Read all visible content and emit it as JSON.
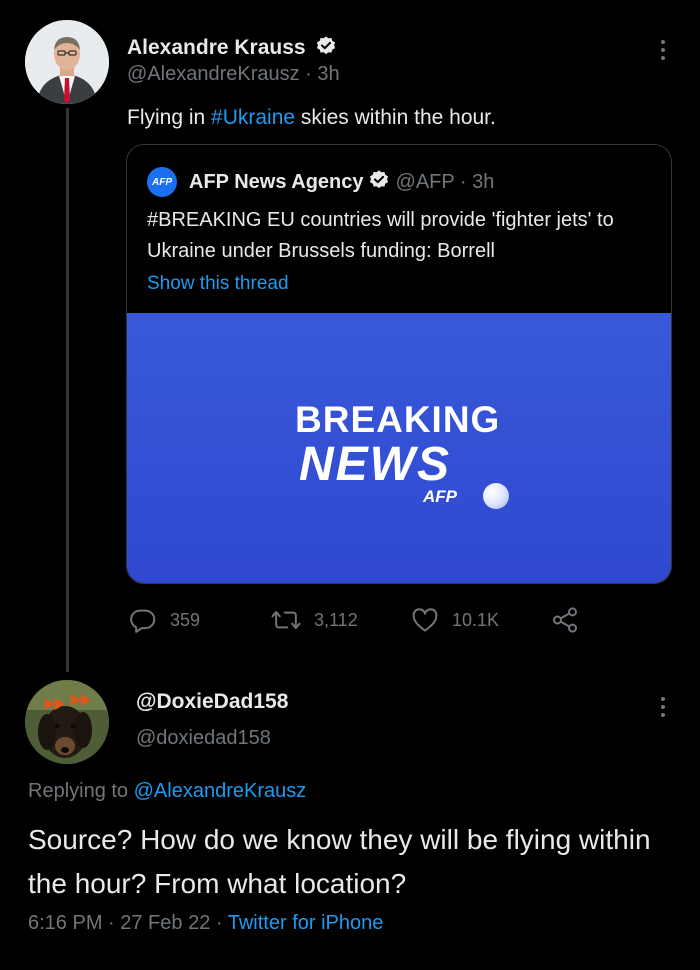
{
  "tweet": {
    "author_name": "Alexandre Krauss",
    "author_handle": "@AlexandreKrausz · 3h",
    "text_prefix": "Flying in ",
    "hashtag": "#Ukraine",
    "text_suffix": " skies within the hour.",
    "quoted": {
      "logo_text": "AFP",
      "author_name": "AFP News Agency",
      "author_handle": "@AFP · 3h",
      "text": "#BREAKING  EU countries will provide 'fighter jets' to Ukraine under Brussels funding: Borrell",
      "show_thread": "Show this thread",
      "image": {
        "line1": "BREAKING",
        "line2": "NEWS",
        "brand": "AFP"
      }
    },
    "actions": {
      "replies": "359",
      "retweets": "3,112",
      "likes": "10.1K"
    }
  },
  "reply": {
    "author_name": "@DoxieDad158",
    "author_handle": "@doxiedad158",
    "replying_label": "Replying to ",
    "replying_to": "@AlexandreKrausz",
    "text": "Source? How do we know they will be flying within the hour? From what location?",
    "time": "6:16 PM · 27 Feb 22 · ",
    "source": "Twitter for iPhone"
  },
  "colors": {
    "background": "#000000",
    "text": "#e7e9ea",
    "muted": "#71767b",
    "accent": "#1d9bf0",
    "verified": "#e7e9ea",
    "breaking_bg": "#3959d9"
  },
  "icons": [
    "verified-badge-icon",
    "more-options-icon",
    "reply-icon",
    "retweet-icon",
    "like-icon",
    "share-icon"
  ]
}
